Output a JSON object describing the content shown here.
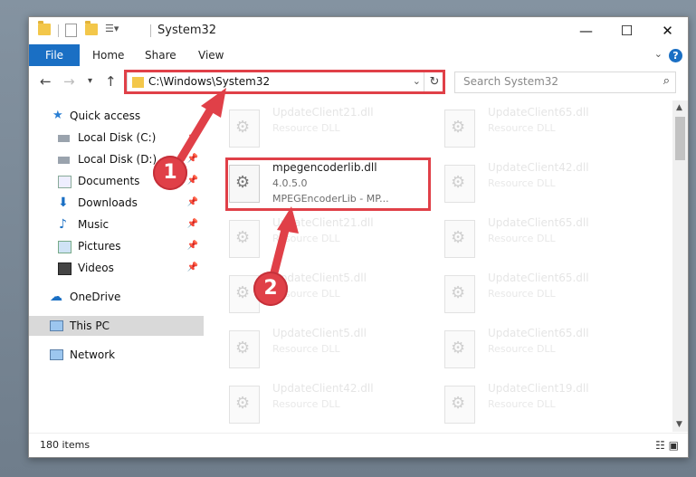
{
  "window": {
    "title": "System32"
  },
  "ribbon": {
    "file": "File",
    "home": "Home",
    "share": "Share",
    "view": "View"
  },
  "address": {
    "path": "C:\\Windows\\System32"
  },
  "search": {
    "placeholder": "Search System32"
  },
  "sidebar": {
    "items": [
      {
        "label": "Quick access"
      },
      {
        "label": "Local Disk (C:)"
      },
      {
        "label": "Local Disk (D:)"
      },
      {
        "label": "Documents"
      },
      {
        "label": "Downloads"
      },
      {
        "label": "Music"
      },
      {
        "label": "Pictures"
      },
      {
        "label": "Videos"
      },
      {
        "label": "OneDrive"
      },
      {
        "label": "This PC"
      },
      {
        "label": "Network"
      }
    ]
  },
  "files": {
    "left": [
      {
        "name": "UpdateClient21.dll",
        "desc": "Resource DLL"
      },
      {
        "name": "mpegencoderlib.dll",
        "version": "4.0.5.0",
        "desc": "MPEGEncoderLib - MP..."
      },
      {
        "name": "UpdateClient21.dll",
        "desc": "Resource DLL"
      },
      {
        "name": "UpdateClient5.dll",
        "desc": "Resource DLL"
      },
      {
        "name": "UpdateClient5.dll",
        "desc": "Resource DLL"
      },
      {
        "name": "UpdateClient42.dll",
        "desc": "Resource DLL"
      }
    ],
    "right": [
      {
        "name": "UpdateClient65.dll",
        "desc": "Resource DLL"
      },
      {
        "name": "UpdateClient42.dll",
        "desc": "Resource DLL"
      },
      {
        "name": "UpdateClient65.dll",
        "desc": "Resource DLL"
      },
      {
        "name": "UpdateClient65.dll",
        "desc": "Resource DLL"
      },
      {
        "name": "UpdateClient65.dll",
        "desc": "Resource DLL"
      },
      {
        "name": "UpdateClient19.dll",
        "desc": "Resource DLL"
      }
    ]
  },
  "status": {
    "count": "180 items"
  },
  "callouts": {
    "one": "1",
    "two": "2"
  },
  "colors": {
    "accent": "#1a6fc4",
    "highlight": "#e04048"
  }
}
